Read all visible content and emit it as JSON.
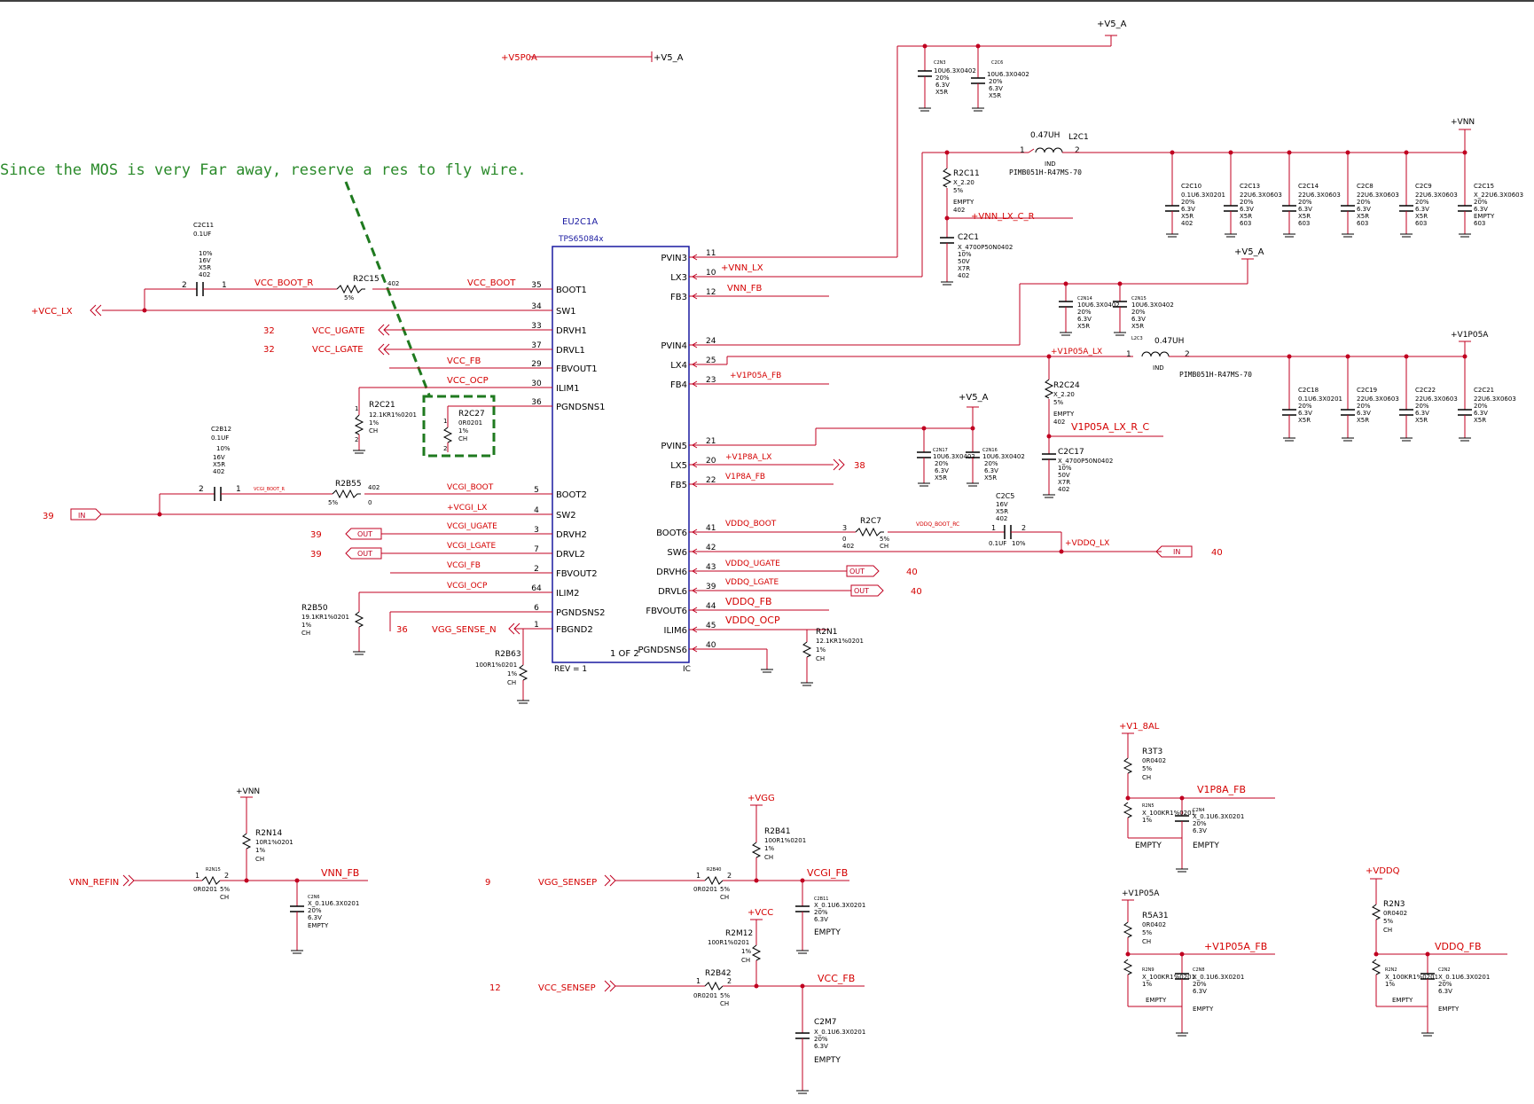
{
  "note": "Since the MOS is very Far away, reserve a res to fly wire.",
  "ic": {
    "refdes": "EU2C1A",
    "part": "TPS65084x",
    "page": "1 OF 2",
    "rev": "REV = 1",
    "ic_label": "IC",
    "left_pins": [
      {
        "name": "BOOT1",
        "num": "35",
        "net": "VCC_BOOT"
      },
      {
        "name": "SW1",
        "num": "34",
        "net": ""
      },
      {
        "name": "DRVH1",
        "num": "33",
        "net": ""
      },
      {
        "name": "DRVL1",
        "num": "37",
        "net": ""
      },
      {
        "name": "FBVOUT1",
        "num": "29",
        "net": "VCC_FB"
      },
      {
        "name": "ILIM1",
        "num": "30",
        "net": "VCC_OCP"
      },
      {
        "name": "PGNDSNS1",
        "num": "36",
        "net": ""
      },
      {
        "name": "BOOT2",
        "num": "5",
        "net": "VCGI_BOOT"
      },
      {
        "name": "SW2",
        "num": "4",
        "net": "+VCGI_LX"
      },
      {
        "name": "DRVH2",
        "num": "3",
        "net": "VCGI_UGATE"
      },
      {
        "name": "DRVL2",
        "num": "7",
        "net": "VCGI_LGATE"
      },
      {
        "name": "FBVOUT2",
        "num": "2",
        "net": "VCGI_FB"
      },
      {
        "name": "ILIM2",
        "num": "64",
        "net": "VCGI_OCP"
      },
      {
        "name": "PGNDSNS2",
        "num": "6",
        "net": ""
      },
      {
        "name": "FBGND2",
        "num": "1",
        "net": ""
      }
    ],
    "right_pins": [
      {
        "name": "PVIN3",
        "num": "11",
        "net": ""
      },
      {
        "name": "LX3",
        "num": "10",
        "net": "+VNN_LX"
      },
      {
        "name": "FB3",
        "num": "12",
        "net": "VNN_FB"
      },
      {
        "name": "PVIN4",
        "num": "24",
        "net": ""
      },
      {
        "name": "LX4",
        "num": "25",
        "net": ""
      },
      {
        "name": "FB4",
        "num": "23",
        "net": "+V1P05A_FB"
      },
      {
        "name": "PVIN5",
        "num": "21",
        "net": ""
      },
      {
        "name": "LX5",
        "num": "20",
        "net": "+V1P8A_LX"
      },
      {
        "name": "FB5",
        "num": "22",
        "net": "V1P8A_FB"
      },
      {
        "name": "BOOT6",
        "num": "41",
        "net": "VDDQ_BOOT"
      },
      {
        "name": "SW6",
        "num": "42",
        "net": ""
      },
      {
        "name": "DRVH6",
        "num": "43",
        "net": "VDDQ_UGATE"
      },
      {
        "name": "DRVL6",
        "num": "39",
        "net": "VDDQ_LGATE"
      },
      {
        "name": "FBVOUT6",
        "num": "44",
        "net": "VDDQ_FB"
      },
      {
        "name": "ILIM6",
        "num": "45",
        "net": "VDDQ_OCP"
      },
      {
        "name": "PGNDSNS6",
        "num": "40",
        "net": ""
      }
    ]
  },
  "labels": {
    "v5p0a": "+V5P0A",
    "v5_a": "+V5_A",
    "v5_a2": "+V5_A",
    "v5_a3": "+V5_A",
    "vnn": "+VNN",
    "v1p05a": "+V1P05A",
    "vcc_lx": "+VCC_LX",
    "vcc_boot_r": "VCC_BOOT_R",
    "vcc_ugate": "VCC_UGATE",
    "vcc_lgate": "VCC_LGATE",
    "n32a": "32",
    "n32b": "32",
    "in_lbl": "IN",
    "out_lbl": "OUT",
    "n39": "39",
    "n39b": "39",
    "n39c": "39",
    "n38": "38",
    "n40a": "40",
    "n40b": "40",
    "n40c": "40",
    "n36": "36",
    "vgg_sense_n": "VGG_SENSE_N",
    "vnn_lx_c_r": "+VNN_LX_C_R",
    "v1p05a_lx": "+V1P05A_LX",
    "v1p05a_lx_r_c": "V1P05A_LX_R_C",
    "vddq_boot_rc": "VDDQ_BOOT_RC",
    "vddq_lx": "+VDDQ_LX",
    "vcgi_boot_r": "VCGI_BOOT_R",
    "l2c1": "L2C1",
    "l2c3": "L2C3",
    "ind047a": "0.47UH",
    "ind047b": "0.47UH",
    "ind_part": "PIMB051H-R47MS-70",
    "ind": "IND",
    "r2c15": "R2C15",
    "r2b55": "R2B55",
    "r2c21": "R2C21",
    "r2c27": "R2C27",
    "r2b50": "R2B50",
    "r2b63": "R2B63",
    "r2c11": "R2C11",
    "r2c24": "R2C24",
    "r2c7": "R2C7",
    "r2n1": "R2N1",
    "c2c11": "C2C11",
    "c2b12": "C2B12",
    "c2c1": "C2C1",
    "c2c17": "C2C17",
    "c2c5": "C2C5",
    "c2c10": "C2C10",
    "c2c18": "C2C18",
    "bottom_vnn": "+VNN",
    "r2n14": "R2N14",
    "vnn_refin": "VNN_REFIN",
    "vnn_fb": "VNN_FB",
    "r2n15": "R2N15",
    "c2n6": "C2N6",
    "vgg": "+VGG",
    "r2b41": "R2B41",
    "vgg_sensep": "VGG_SENSEP",
    "vcgi_fb": "VCGI_FB",
    "r2b40": "R2B40",
    "c2b11": "C2B11",
    "n9": "9",
    "vcc": "+VCC",
    "r2m12": "R2M12",
    "vcc_sensep": "VCC_SENSEP",
    "vcc_fb": "VCC_FB",
    "r2b42": "R2B42",
    "c2m7": "C2M7",
    "n12": "12",
    "v1_8al": "+V1_8AL",
    "r3t3": "R3T3",
    "v1p8a_fb": "V1P8A_FB",
    "r2n5": "R2N5",
    "c2n4": "C2N4",
    "v1p05a_b": "+V1P05A",
    "r5a31": "R5A31",
    "v1p05a_fb": "+V1P05A_FB",
    "r2n9": "R2N9",
    "c2n8": "C2N8",
    "vddq": "+VDDQ",
    "r2n3": "R2N3",
    "vddq_fb": "VDDQ_FB",
    "r2n2": "R2N2",
    "c2n2": "C2N2",
    "empty": "EMPTY"
  },
  "colors": {
    "wire": "#c00020",
    "net": "#d40000",
    "blue": "#1a1aa0",
    "note": "#2a8a2a",
    "black": "#000000"
  }
}
